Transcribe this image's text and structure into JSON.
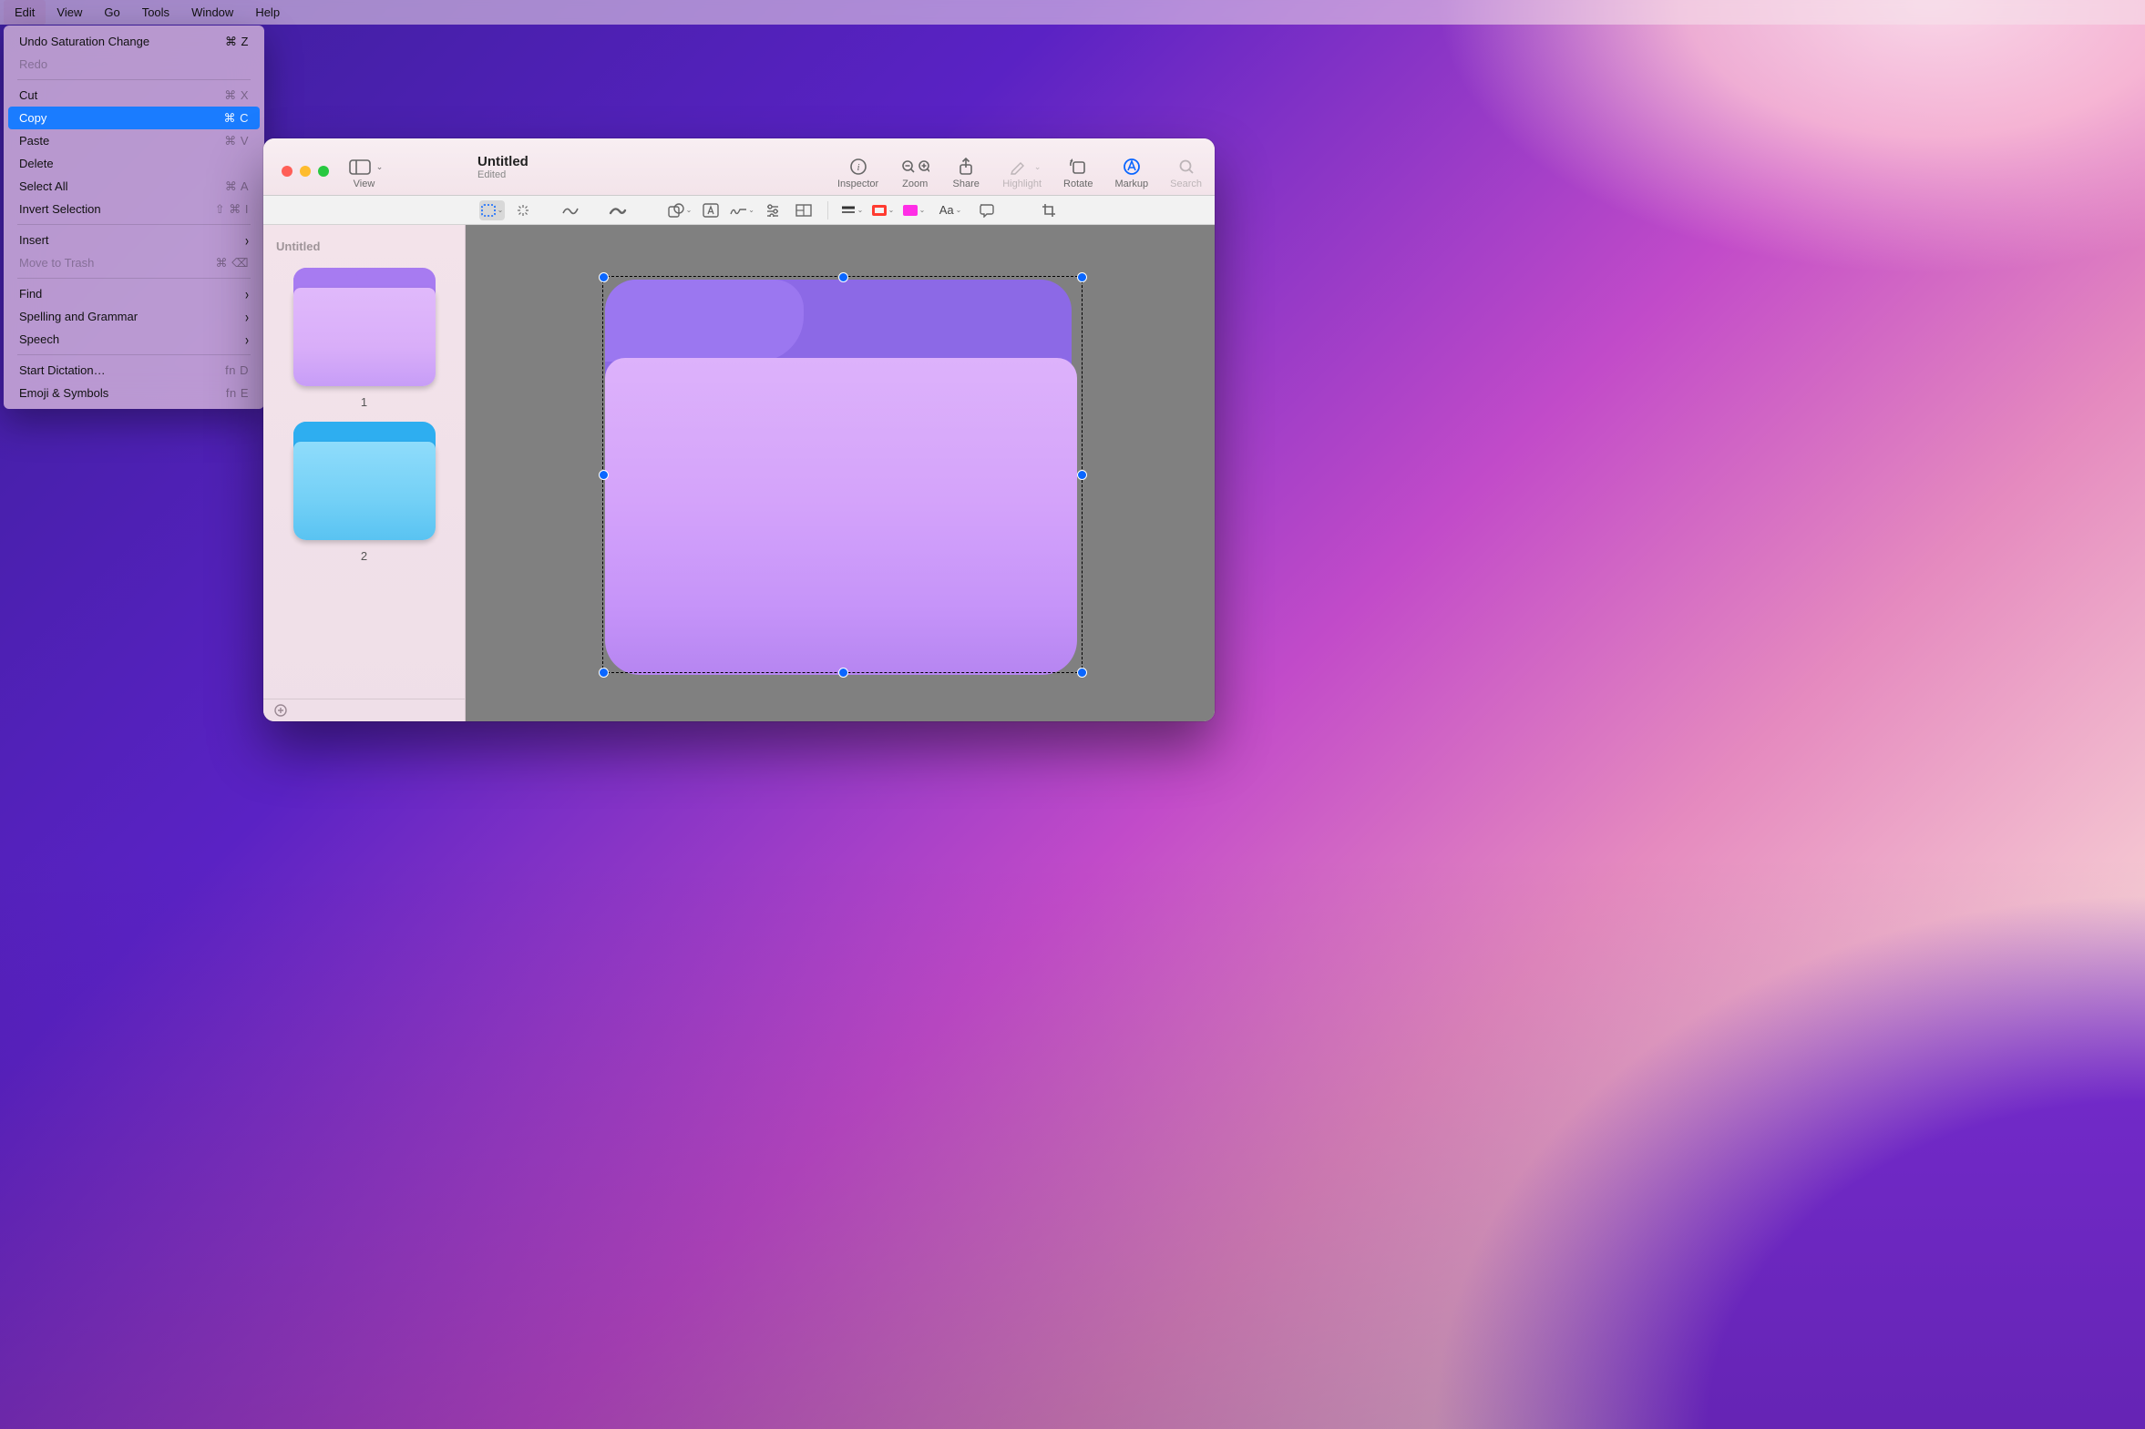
{
  "menubar": {
    "items": [
      "Edit",
      "View",
      "Go",
      "Tools",
      "Window",
      "Help"
    ],
    "open_index": 0
  },
  "edit_menu": [
    {
      "kind": "item",
      "label": "Undo Saturation Change",
      "shortcut": "⌘ Z"
    },
    {
      "kind": "item",
      "label": "Redo",
      "disabled": true
    },
    {
      "kind": "sep"
    },
    {
      "kind": "item",
      "label": "Cut",
      "shortcut": "⌘ X",
      "sc_grey": true
    },
    {
      "kind": "item",
      "label": "Copy",
      "shortcut": "⌘ C",
      "selected": true
    },
    {
      "kind": "item",
      "label": "Paste",
      "shortcut": "⌘ V",
      "sc_grey": true
    },
    {
      "kind": "item",
      "label": "Delete"
    },
    {
      "kind": "item",
      "label": "Select All",
      "shortcut": "⌘ A",
      "sc_grey": true
    },
    {
      "kind": "item",
      "label": "Invert Selection",
      "shortcut": "⇧ ⌘  I",
      "sc_grey": true
    },
    {
      "kind": "sep"
    },
    {
      "kind": "item",
      "label": "Insert",
      "sub": true
    },
    {
      "kind": "item",
      "label": "Move to Trash",
      "shortcut": "⌘ ⌫",
      "disabled": true,
      "sc_grey": true
    },
    {
      "kind": "sep"
    },
    {
      "kind": "item",
      "label": "Find",
      "sub": true
    },
    {
      "kind": "item",
      "label": "Spelling and Grammar",
      "sub": true
    },
    {
      "kind": "item",
      "label": "Speech",
      "sub": true
    },
    {
      "kind": "sep"
    },
    {
      "kind": "item",
      "label": "Start Dictation…",
      "shortcut": "fn D",
      "sc_grey": true
    },
    {
      "kind": "item",
      "label": "Emoji & Symbols",
      "shortcut": "fn E",
      "sc_grey": true
    }
  ],
  "window": {
    "title": "Untitled",
    "subtitle": "Edited",
    "toolbar": [
      {
        "id": "view",
        "label": "View",
        "sub_chev": true
      },
      {
        "id": "inspector",
        "label": "Inspector"
      },
      {
        "id": "zoom",
        "label": "Zoom"
      },
      {
        "id": "share",
        "label": "Share"
      },
      {
        "id": "highlight",
        "label": "Highlight",
        "sub_chev": true,
        "dis": true
      },
      {
        "id": "rotate",
        "label": "Rotate"
      },
      {
        "id": "markup",
        "label": "Markup",
        "active": true
      },
      {
        "id": "search",
        "label": "Search",
        "dis": true
      }
    ]
  },
  "sidebar": {
    "title": "Untitled",
    "pages": [
      {
        "num": "1",
        "color": "purple"
      },
      {
        "num": "2",
        "color": "blue"
      }
    ]
  },
  "colors": {
    "border_swatch": "#ff3b30",
    "fill_swatch": "#ff2ee6"
  }
}
